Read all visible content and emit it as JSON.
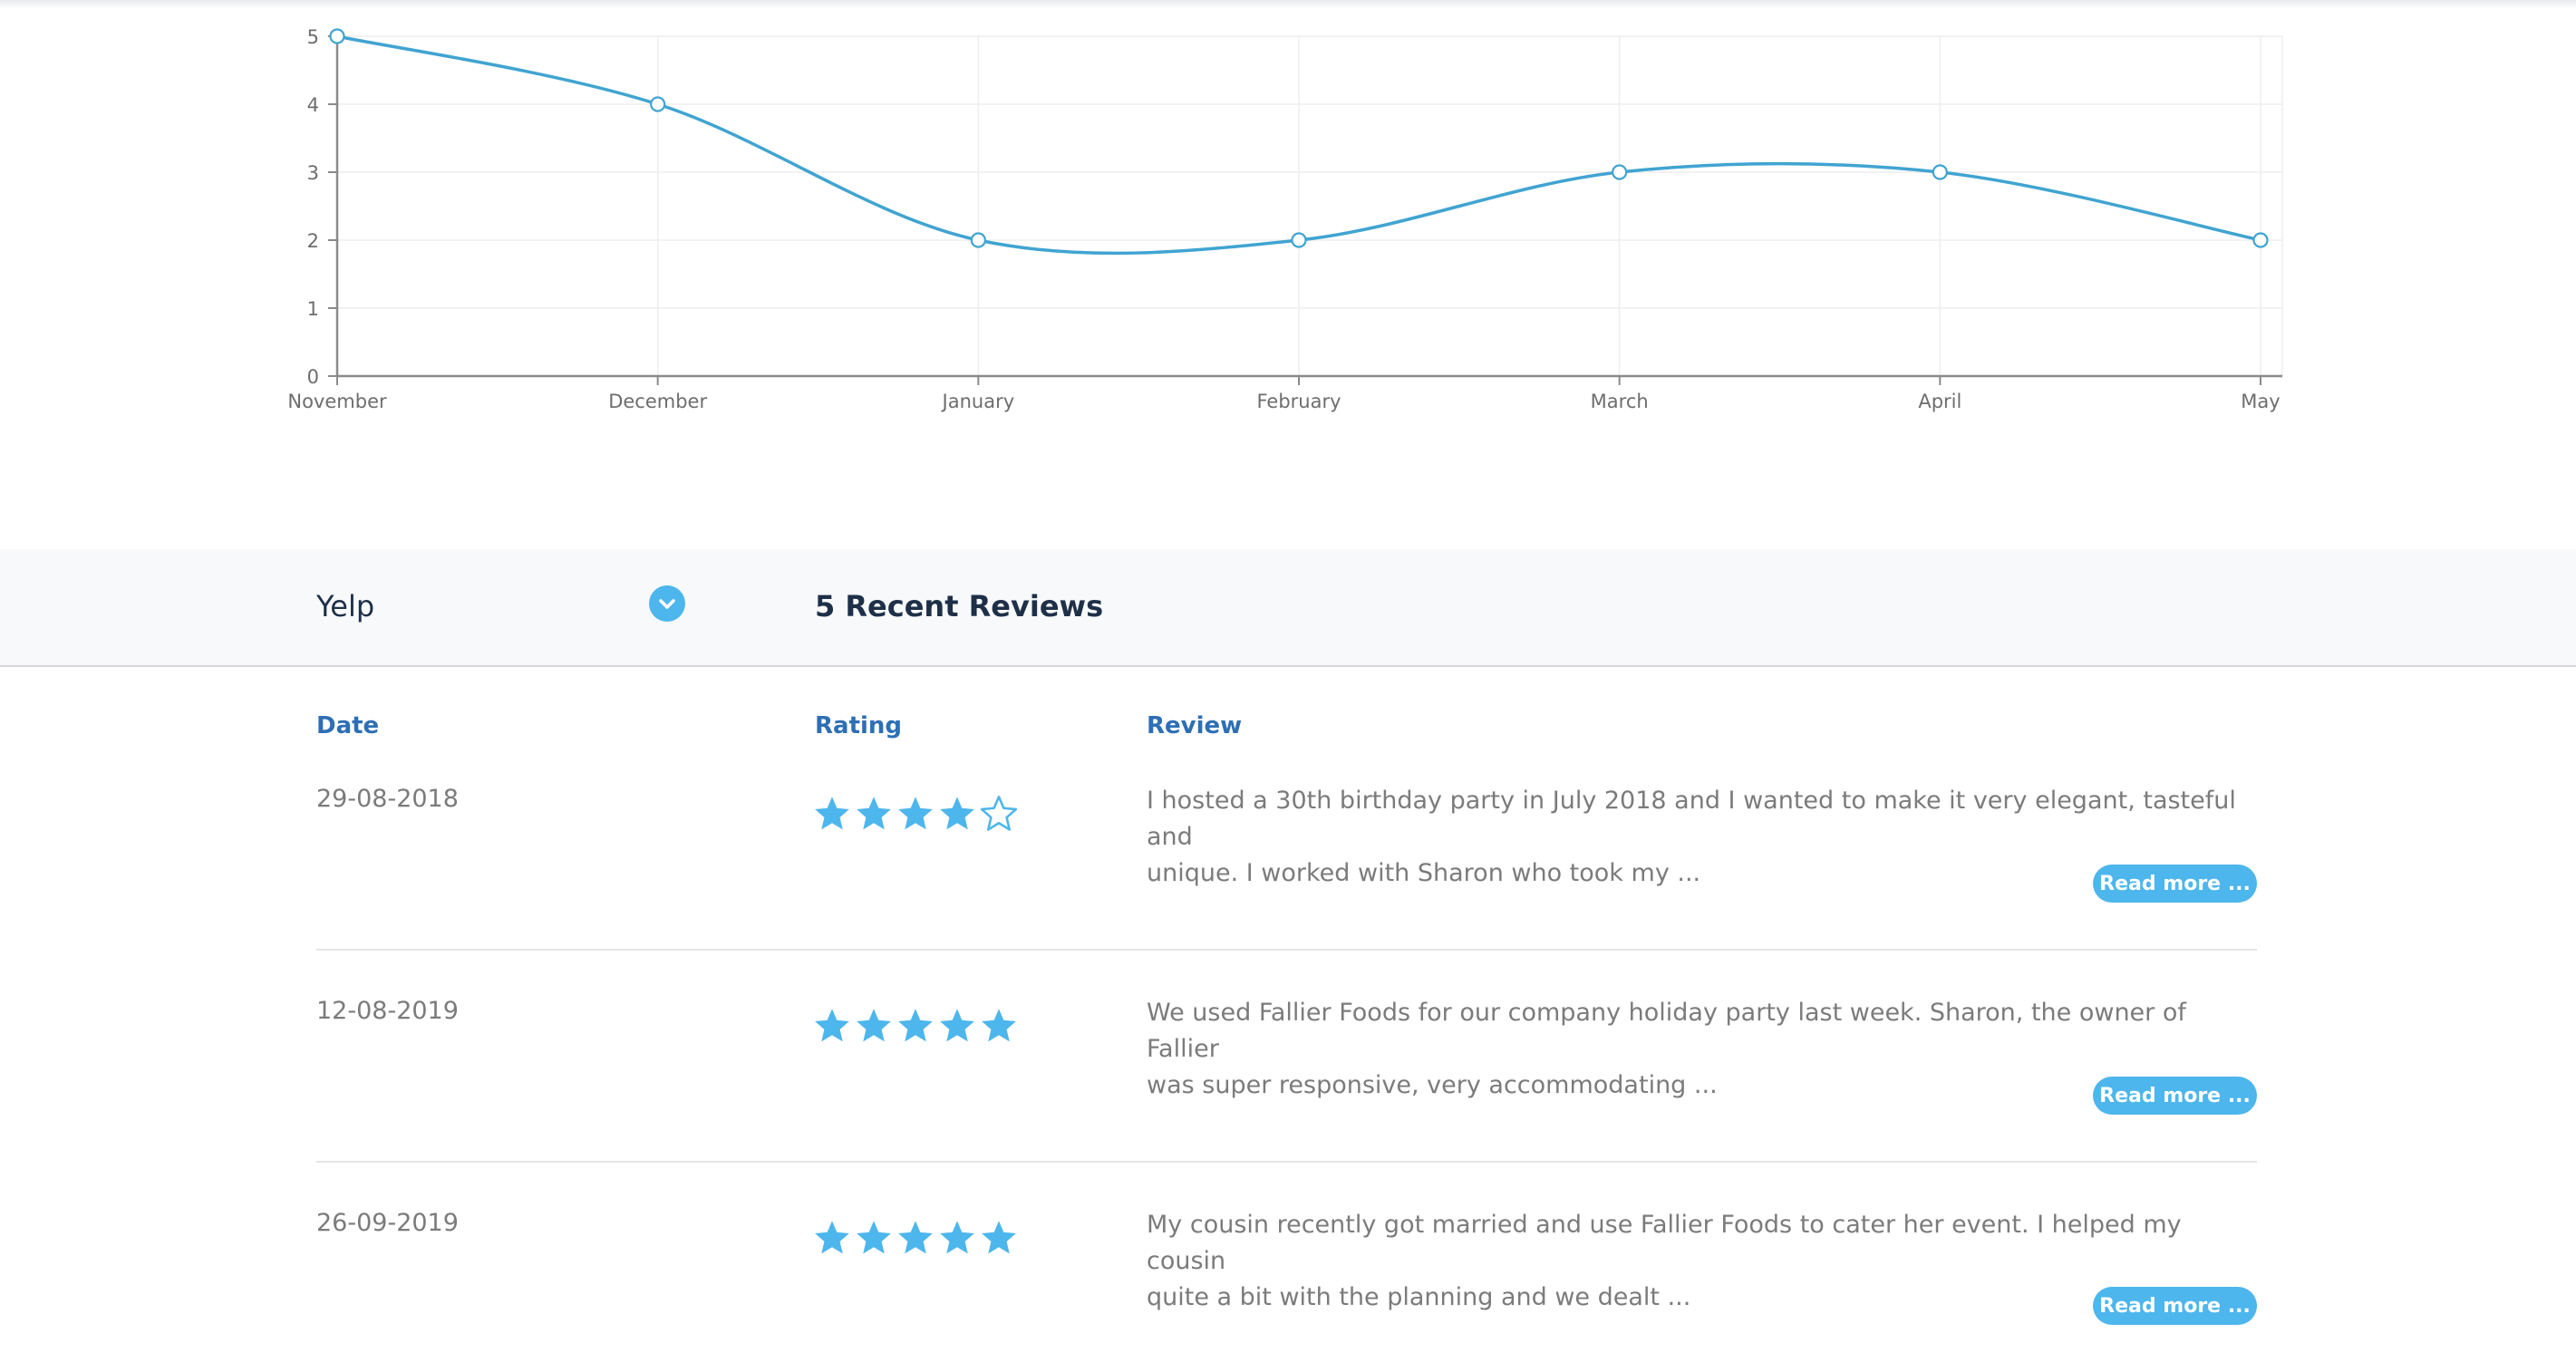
{
  "chart_data": {
    "type": "line",
    "categories": [
      "November",
      "December",
      "January",
      "February",
      "March",
      "April",
      "May"
    ],
    "values": [
      5,
      4,
      2,
      2,
      3,
      3,
      2
    ],
    "yticks": [
      "0",
      "1",
      "2",
      "3",
      "4",
      "5"
    ],
    "ylim": [
      0,
      5
    ],
    "grid": true,
    "smooth": true,
    "color": "#40a4d1"
  },
  "source_bar": {
    "source": "Yelp",
    "title": "5 Recent Reviews",
    "toggle_icon": "chevron-down-icon"
  },
  "table": {
    "headers": {
      "date": "Date",
      "rating": "Rating",
      "review": "Review"
    },
    "rows": [
      {
        "date": "29-08-2018",
        "rating": 4,
        "review_line1": "I hosted a 30th birthday party in July 2018 and I wanted to make it very elegant, tasteful and",
        "review_line2": "unique. I worked with Sharon who took my ...",
        "button": "Read more ..."
      },
      {
        "date": "12-08-2019",
        "rating": 5,
        "review_line1": "We used Fallier Foods for our company holiday party last week. Sharon, the owner of Fallier",
        "review_line2": "was super responsive, very accommodating ...",
        "button": "Read more ..."
      },
      {
        "date": "26-09-2019",
        "rating": 5,
        "review_line1": "My cousin recently got married and use Fallier Foods to cater her event. I helped my cousin",
        "review_line2": "quite a bit with the planning and we dealt ...",
        "button": "Read more ..."
      }
    ]
  },
  "colors": {
    "accent": "#4db6ec",
    "header_blue": "#2e6fb5",
    "text": "#7b7b7b"
  }
}
